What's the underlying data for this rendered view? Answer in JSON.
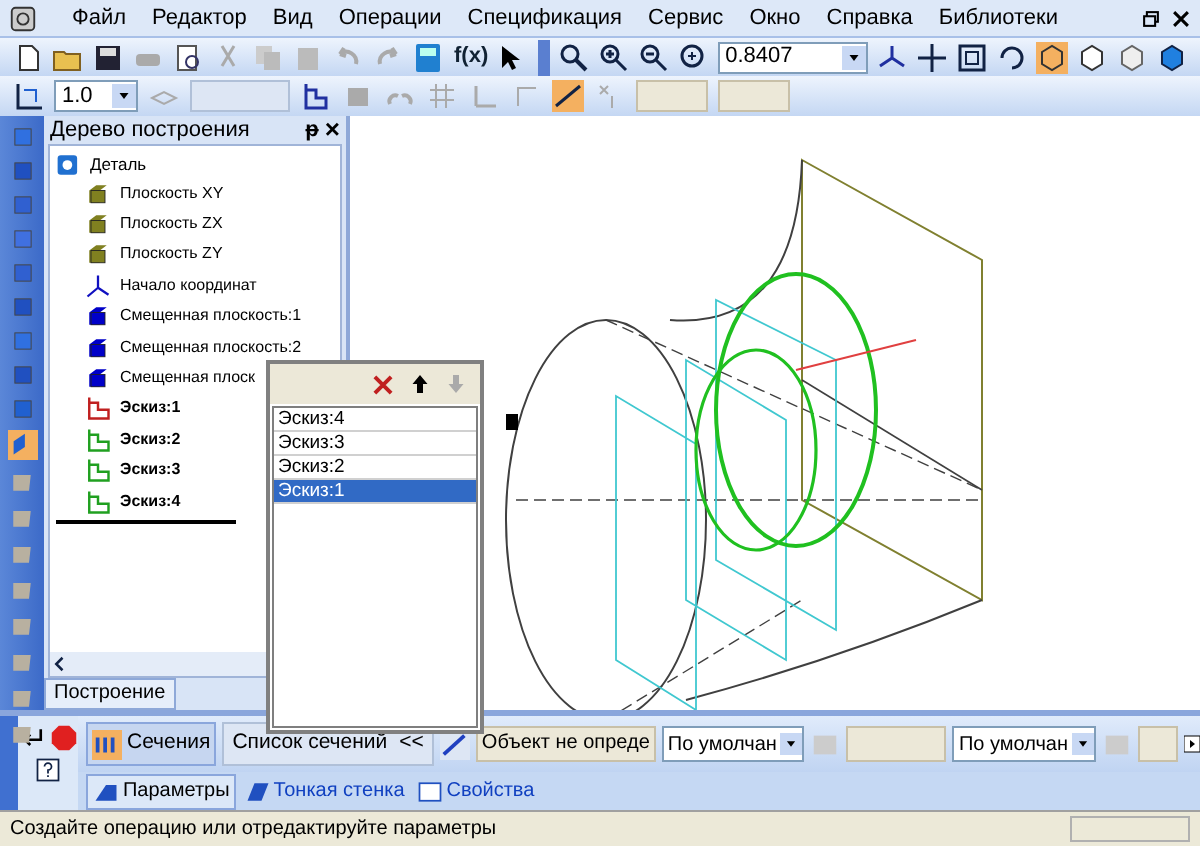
{
  "menu": [
    "Файл",
    "Редактор",
    "Вид",
    "Операции",
    "Спецификация",
    "Сервис",
    "Окно",
    "Справка",
    "Библиотеки"
  ],
  "toolbar": {
    "fx": "f(x)",
    "zoom_value": "0.8407",
    "step_value": "1.0"
  },
  "tree": {
    "title": "Дерево построения",
    "pin": "ᵽ",
    "close": "×",
    "root": "Деталь",
    "items": [
      {
        "label": "Плоскость XY",
        "kind": "plane",
        "color": "#808020",
        "bold": false
      },
      {
        "label": "Плоскость ZX",
        "kind": "plane",
        "color": "#808020",
        "bold": false
      },
      {
        "label": "Плоскость ZY",
        "kind": "plane",
        "color": "#808020",
        "bold": false
      },
      {
        "label": "Начало координат",
        "kind": "origin",
        "color": "#1010c0",
        "bold": false
      },
      {
        "label": "Смещенная плоскость:1",
        "kind": "plane",
        "color": "#0000c8",
        "bold": false
      },
      {
        "label": "Смещенная плоскость:2",
        "kind": "plane",
        "color": "#0000c8",
        "bold": false
      },
      {
        "label": "Смещенная плоск",
        "kind": "plane",
        "color": "#0000c8",
        "bold": false
      },
      {
        "label": "Эскиз:1",
        "kind": "sketch",
        "color": "#c02020",
        "bold": true
      },
      {
        "label": "Эскиз:2",
        "kind": "sketch",
        "color": "#20a020",
        "bold": true
      },
      {
        "label": "Эскиз:3",
        "kind": "sketch",
        "color": "#20a020",
        "bold": true
      },
      {
        "label": "Эскиз:4",
        "kind": "sketch",
        "color": "#20a020",
        "bold": true
      }
    ],
    "tab": "Построение"
  },
  "sections_list": {
    "items": [
      {
        "label": "Эскиз:4",
        "selected": false
      },
      {
        "label": "Эскиз:3",
        "selected": false
      },
      {
        "label": "Эскиз:2",
        "selected": false
      },
      {
        "label": "Эскиз:1",
        "selected": true
      }
    ]
  },
  "properties": {
    "sections_button": "Сечения",
    "list_button": "Список сечений",
    "collapse": "<<",
    "object_field": "Объект не опреде",
    "combo_1": "По умолчан",
    "combo_2": "По умолчан",
    "tabs": [
      {
        "label": "Параметры",
        "selected": true
      },
      {
        "label": "Тонкая стенка",
        "selected": false
      },
      {
        "label": "Свойства",
        "selected": false
      }
    ]
  },
  "status_bar": "Создайте операцию или отредактируйте параметры"
}
